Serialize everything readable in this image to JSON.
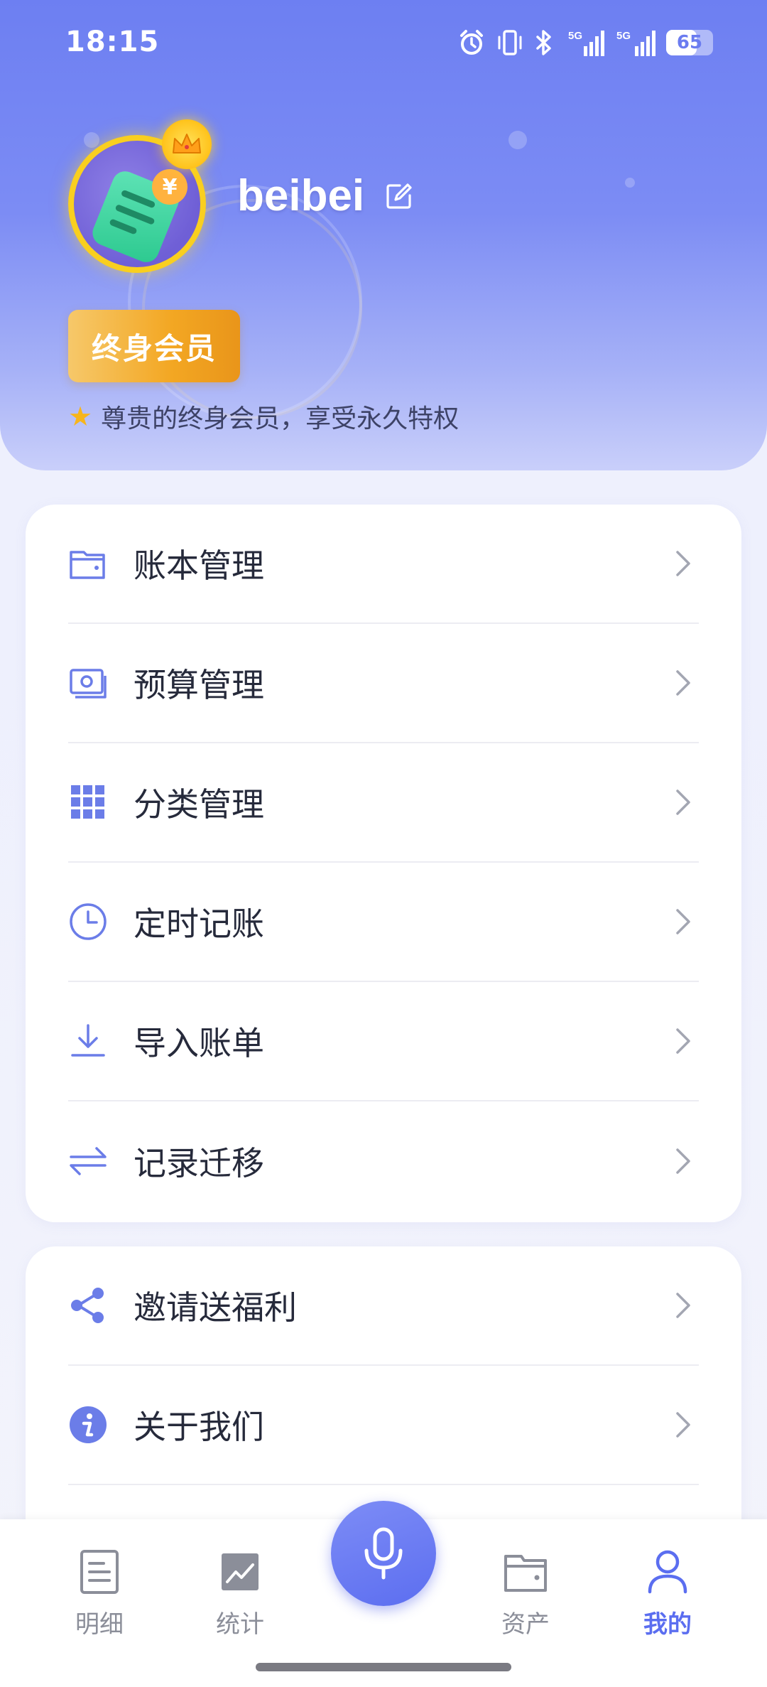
{
  "status_bar": {
    "time": "18:15",
    "battery": "65",
    "battery_level_percent": 65,
    "icons": [
      "alarm-icon",
      "vibrate-icon",
      "bluetooth-icon",
      "5g-signal-icon",
      "5g-signal-icon",
      "battery-icon"
    ]
  },
  "profile": {
    "username": "beibei",
    "member_badge": "终身会员",
    "member_desc": "尊贵的终身会员，享受永久特权",
    "accent_color": "#6d7ff2",
    "badge_color": "#f3a723"
  },
  "menu_group_1": [
    {
      "label": "账本管理",
      "icon": "wallet-icon"
    },
    {
      "label": "预算管理",
      "icon": "budget-icon"
    },
    {
      "label": "分类管理",
      "icon": "grid-icon"
    },
    {
      "label": "定时记账",
      "icon": "clock-icon"
    },
    {
      "label": "导入账单",
      "icon": "download-icon"
    },
    {
      "label": "记录迁移",
      "icon": "transfer-icon"
    }
  ],
  "menu_group_2": [
    {
      "label": "邀请送福利",
      "icon": "share-icon"
    },
    {
      "label": "关于我们",
      "icon": "info-icon"
    }
  ],
  "bottom_nav": [
    {
      "label": "明细",
      "icon": "document-icon",
      "active": false
    },
    {
      "label": "统计",
      "icon": "chart-icon",
      "active": false
    },
    {
      "label": "资产",
      "icon": "wallet-icon",
      "active": false
    },
    {
      "label": "我的",
      "icon": "user-icon",
      "active": true
    }
  ],
  "nav_active_color": "#5b6ef0"
}
